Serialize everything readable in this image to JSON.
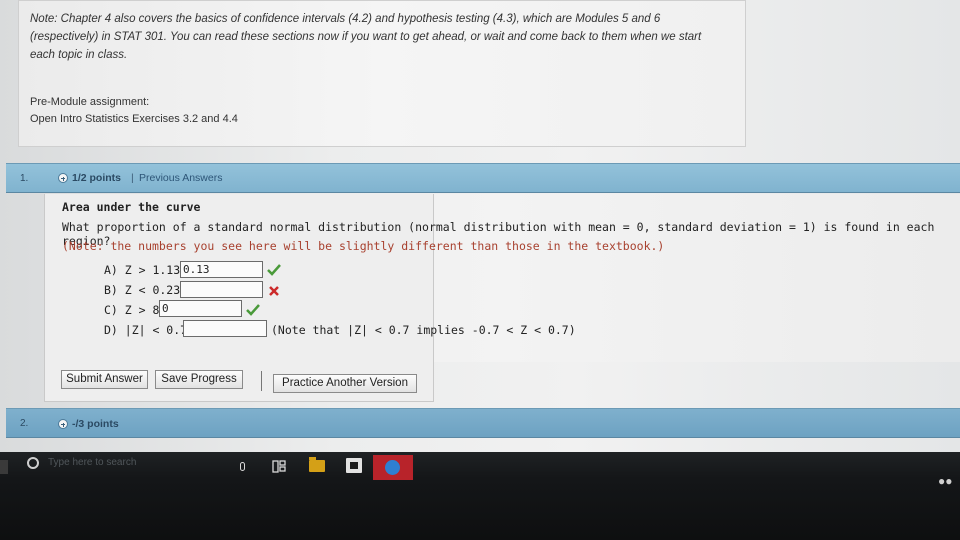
{
  "intro": {
    "note": "Note: Chapter 4 also covers the basics of confidence intervals (4.2) and hypothesis testing (4.3), which are Modules 5 and 6 (respectively) in STAT 301. You can read these sections now if you want to get ahead, or wait and come back to them when we start each topic in class.",
    "premodule_label": "Pre-Module assignment:",
    "premodule_value": "Open Intro Statistics Exercises 3.2 and 4.4"
  },
  "question1": {
    "number": "1.",
    "points": "1/2 points",
    "separator": "|",
    "previous_answers": "Previous Answers",
    "title": "Area under the curve",
    "text": "What proportion of a standard normal distribution (normal distribution with mean = 0, standard deviation = 1) is found in each region?",
    "note": "(Note: the numbers you see here will be slightly different than those in the textbook.)",
    "parts": [
      {
        "label": "A) Z > 1.13",
        "value": "0.13",
        "status": "correct"
      },
      {
        "label": "B) Z < 0.23",
        "value": "",
        "status": "incorrect"
      },
      {
        "label": "C) Z > 8",
        "value": "0",
        "status": "correct"
      },
      {
        "label": "D) |Z| < 0.7",
        "value": "",
        "status": "none"
      }
    ],
    "part_d_note": "(Note that |Z| < 0.7 implies -0.7 < Z < 0.7)",
    "buttons": {
      "submit": "Submit Answer",
      "save": "Save Progress",
      "practice": "Practice Another Version"
    }
  },
  "question2": {
    "number": "2.",
    "points": "-/3 points"
  },
  "taskbar": {
    "search_placeholder": "Type here to search",
    "icons": [
      "search-icon",
      "microphone-icon",
      "task-view-icon",
      "file-explorer-icon",
      "store-icon",
      "edge-icon",
      "people-icon"
    ]
  },
  "colors": {
    "question_bar": "#89bad5",
    "correct": "#4a9a3a",
    "incorrect": "#cc2a2a",
    "note_red": "#a8412f",
    "taskbar": "#141618"
  }
}
